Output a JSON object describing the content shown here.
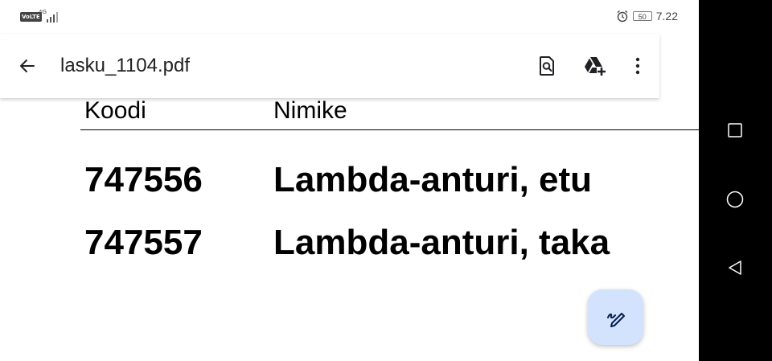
{
  "status_bar": {
    "volte": "VoLTE",
    "network": "4G",
    "battery": "50",
    "time": "7.22"
  },
  "app_bar": {
    "title": "lasku_1104.pdf",
    "icons": [
      "back-arrow-icon",
      "find-in-page-icon",
      "add-to-drive-icon",
      "more-vert-icon"
    ]
  },
  "document": {
    "headers": [
      "Koodi",
      "Nimike"
    ],
    "rows": [
      {
        "code": "747556",
        "name": "Lambda-anturi, etu"
      },
      {
        "code": "747557",
        "name": "Lambda-anturi, taka"
      }
    ]
  },
  "fab": {
    "icon": "edit-draw-icon"
  },
  "nav_bar": {
    "icons": [
      "recent-apps-icon",
      "home-icon",
      "back-icon"
    ]
  },
  "colors": {
    "fab_background": "#d3e3fd",
    "nav_background": "#000000",
    "text_primary": "#202124"
  }
}
